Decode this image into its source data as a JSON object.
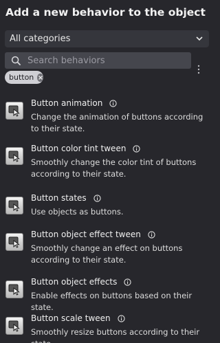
{
  "dialog": {
    "title": "Add a new behavior to the object"
  },
  "category_select": {
    "value": "All categories"
  },
  "search": {
    "placeholder": "Search behaviors"
  },
  "filter_chip": {
    "label": "button"
  },
  "behaviors": [
    {
      "name": "Button animation",
      "description": "Change the animation of buttons according to their state."
    },
    {
      "name": "Button color tint tween",
      "description": "Smoothly change the color tint of buttons according to their state."
    },
    {
      "name": "Button states",
      "description": "Use objects as buttons."
    },
    {
      "name": "Button object effect tween",
      "description": "Smoothly change an effect on buttons according to their state."
    },
    {
      "name": "Button object effects",
      "description": "Enable effects on buttons based on their state."
    },
    {
      "name": "Button scale tween",
      "description": "Smoothly resize buttons according to their state."
    }
  ],
  "colors": {
    "background": "#27272c",
    "input_bg": "#45464d",
    "select_bg": "#35363c",
    "chip_bg": "#cfcfd4"
  }
}
